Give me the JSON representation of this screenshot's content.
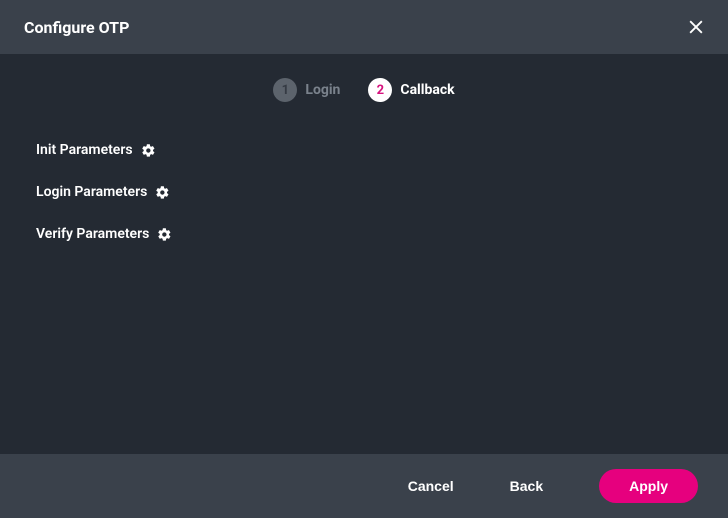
{
  "header": {
    "title": "Configure OTP"
  },
  "stepper": {
    "step1": {
      "num": "1",
      "label": "Login"
    },
    "step2": {
      "num": "2",
      "label": "Callback"
    }
  },
  "params": {
    "init": "Init Parameters",
    "login": "Login Parameters",
    "verify": "Verify Parameters"
  },
  "footer": {
    "cancel": "Cancel",
    "back": "Back",
    "apply": "Apply"
  }
}
